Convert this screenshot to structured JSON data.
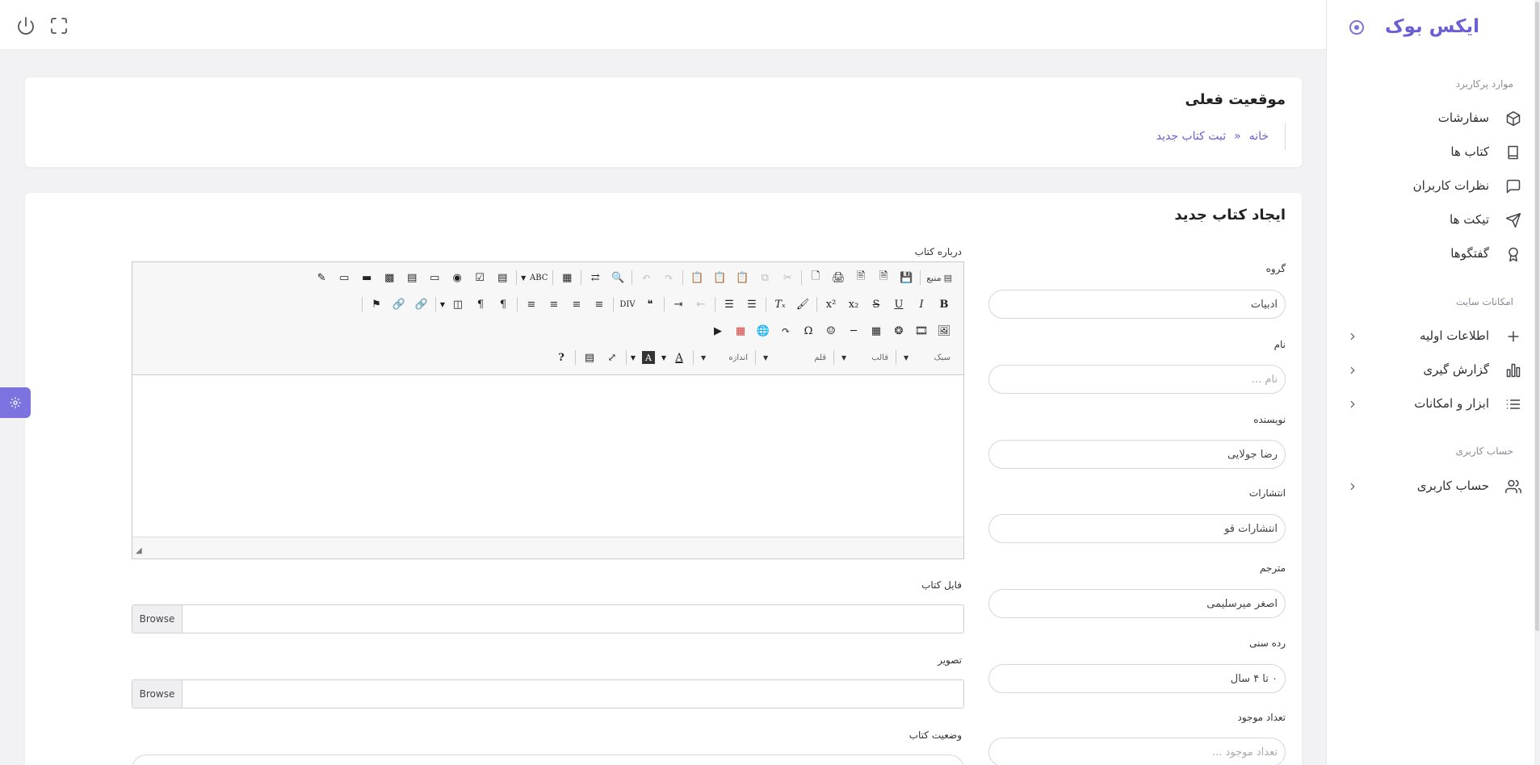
{
  "brand": {
    "name": "ایکس بوک",
    "accent": "#6a5fd4"
  },
  "sidebar": {
    "sections": [
      {
        "title": "موارد پرکاربرد"
      },
      {
        "title": "امکانات سایت"
      },
      {
        "title": "حساب کاربری"
      }
    ],
    "items": [
      {
        "label": "سفارشات",
        "icon": "box-icon"
      },
      {
        "label": "کتاب ها",
        "icon": "book-icon"
      },
      {
        "label": "نظرات کاربران",
        "icon": "message-square-icon"
      },
      {
        "label": "تیکت ها",
        "icon": "send-icon"
      },
      {
        "label": "گفتگوها",
        "icon": "award-icon"
      },
      {
        "label": "اطلاعات اولیه",
        "icon": "plus-icon"
      },
      {
        "label": "گزارش گیری",
        "icon": "bar-chart-icon"
      },
      {
        "label": "ابزار و امکانات",
        "icon": "list-icon"
      },
      {
        "label": "حساب کاربری",
        "icon": "users-icon"
      }
    ]
  },
  "breadcrumb": {
    "title": "موقعیت فعلی",
    "home": "خانه",
    "separator": "«",
    "current": "ثبت کتاب جدید"
  },
  "form": {
    "title": "ایجاد کتاب جدید",
    "group": {
      "label": "گروه",
      "value": "ادبیات"
    },
    "name": {
      "label": "نام",
      "placeholder": "نام ..."
    },
    "author": {
      "label": "نویسنده",
      "value": "رضا جولایی"
    },
    "publisher": {
      "label": "انتشارات",
      "value": "انتشارات قو"
    },
    "translator": {
      "label": "مترجم",
      "value": "اصغر میرسلیمی"
    },
    "age": {
      "label": "رده سنی",
      "value": "۰ تا ۴ سال"
    },
    "stock": {
      "label": "تعداد موجود",
      "placeholder": "تعداد موجود ..."
    },
    "about": {
      "label": "درباره کتاب"
    },
    "book_file": {
      "label": "فایل کتاب",
      "button": "Browse"
    },
    "image": {
      "label": "تصویر",
      "button": "Browse"
    },
    "status": {
      "label": "وضعیت کتاب"
    }
  },
  "editor": {
    "source_label": "منبع",
    "style_combo": "سبک",
    "format_combo": "قالب",
    "font_combo": "قلم",
    "size_combo": "اندازه"
  }
}
